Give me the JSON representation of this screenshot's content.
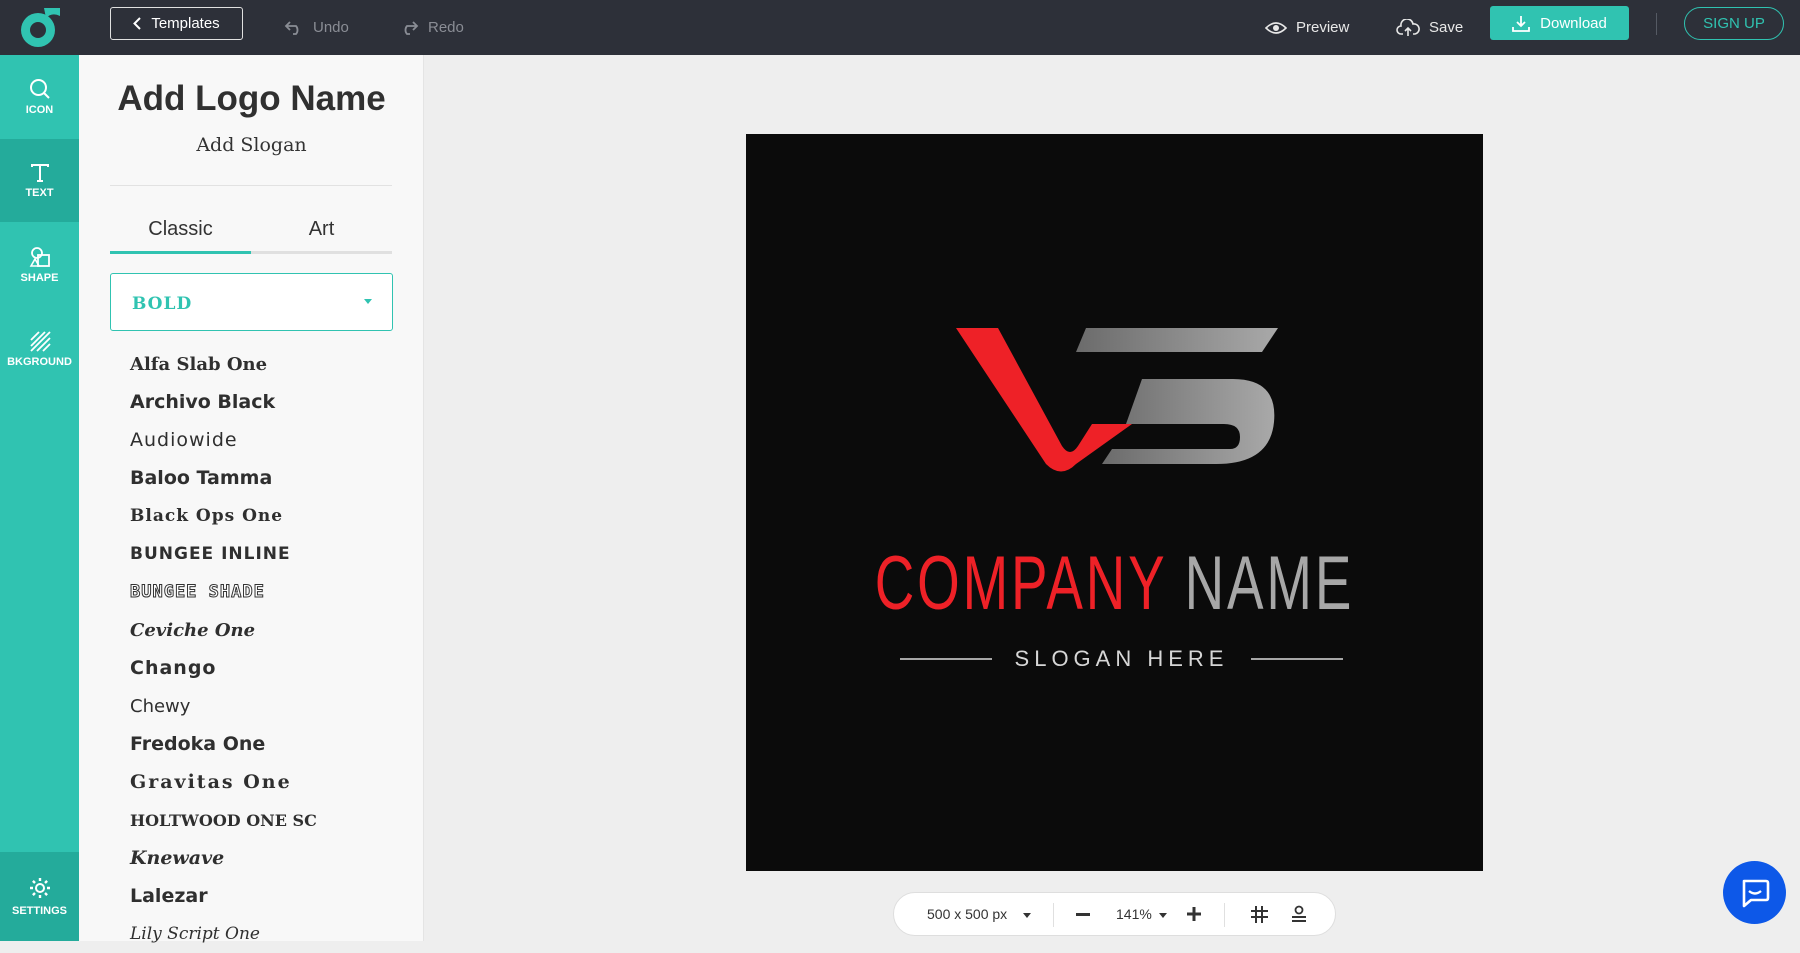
{
  "topbar": {
    "templates_label": "Templates",
    "undo_label": "Undo",
    "redo_label": "Redo",
    "preview_label": "Preview",
    "save_label": "Save",
    "download_label": "Download",
    "signup_label": "SIGN UP"
  },
  "rail": {
    "items": [
      {
        "label": "ICON",
        "icon": "search-icon"
      },
      {
        "label": "TEXT",
        "icon": "text-icon"
      },
      {
        "label": "SHAPE",
        "icon": "shapes-icon"
      },
      {
        "label": "BKGROUND",
        "icon": "background-stripes-icon"
      }
    ],
    "active": "TEXT",
    "settings_label": "SETTINGS"
  },
  "panel": {
    "logo_name": "Add Logo Name",
    "slogan": "Add Slogan",
    "tabs": [
      {
        "label": "Classic"
      },
      {
        "label": "Art"
      }
    ],
    "active_tab": "Classic",
    "category_select": "BOLD",
    "fonts": [
      "Alfa Slab One",
      "Archivo Black",
      "Audiowide",
      "Baloo Tamma",
      "Black Ops One",
      "BUNGEE INLINE",
      "BUNGEE SHADE",
      "Ceviche One",
      "Chango",
      "Chewy",
      "Fredoka One",
      "Gravitas One",
      "HOLTWOOD ONE SC",
      "Knewave",
      "Lalezar",
      "Lily Script One"
    ]
  },
  "canvas": {
    "company_word1": "COMPANY",
    "company_word2": "NAME",
    "slogan": "SLOGAN HERE",
    "background": "#0b0b0b",
    "accent_red": "#ee2127",
    "accent_gray": "#a7a7a7"
  },
  "bottombar": {
    "size": "500 x 500 px",
    "zoom": "141%"
  },
  "colors": {
    "brand_teal": "#30c3b1",
    "topbar_bg": "#2d3039",
    "chat_blue": "#0d58e8"
  }
}
